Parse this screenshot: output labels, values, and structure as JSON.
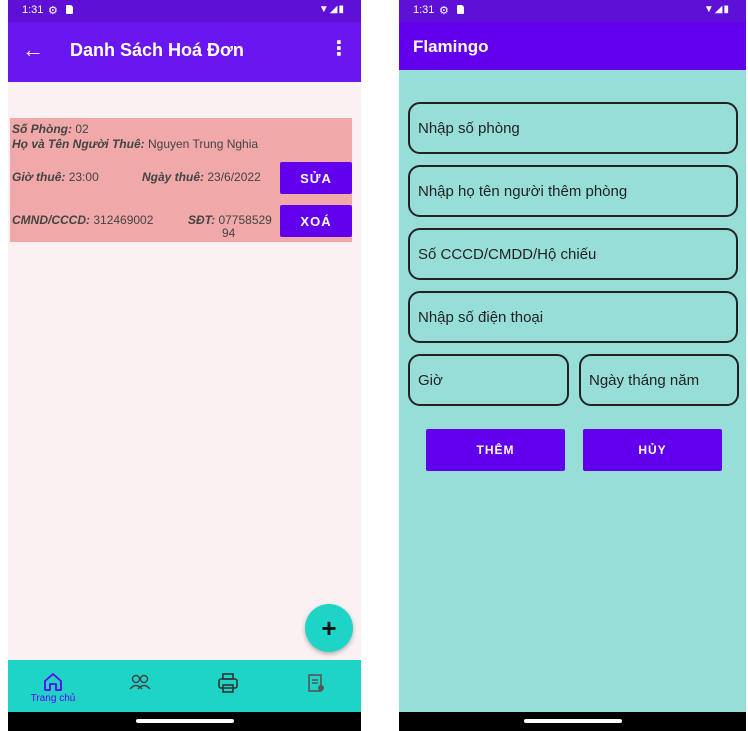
{
  "left": {
    "status": {
      "time": "1:31"
    },
    "app_bar": {
      "title": "Danh Sách Hoá Đơn"
    },
    "record": {
      "room_label": "Số Phòng:",
      "room_value": "02",
      "name_label": "Họ và Tên Người Thuê:",
      "name_value": "Nguyen Trung Nghia",
      "time_label": "Giờ thuê:",
      "time_value": "23:00",
      "date_label": "Ngày thuê:",
      "date_value": "23/6/2022",
      "id_label": "CMND/CCCD:",
      "id_value": "312469002",
      "phone_label": "SĐT:",
      "phone_value_line1": "07758529",
      "phone_value_line2": "94",
      "edit_label": "SỬA",
      "delete_label": "XOÁ"
    },
    "fab_label": "+",
    "bottom_nav": {
      "home_label": "Trang chủ"
    }
  },
  "right": {
    "status": {
      "time": "1:31"
    },
    "app_bar": {
      "title": "Flamingo"
    },
    "form": {
      "room_placeholder": "Nhập số phòng",
      "name_placeholder": "Nhập họ tên người thêm phòng",
      "id_placeholder": "Số CCCD/CMDD/Hộ chiếu",
      "phone_placeholder": "Nhập số điện thoại",
      "hour_placeholder": "Giờ",
      "date_placeholder": "Ngày tháng năm",
      "add_label": "THÊM",
      "cancel_label": "HỦY"
    }
  },
  "colors": {
    "primary": "#6200ee",
    "teal": "#1ed4c7",
    "card": "#f1a8a8",
    "form_bg": "#98ded8"
  }
}
